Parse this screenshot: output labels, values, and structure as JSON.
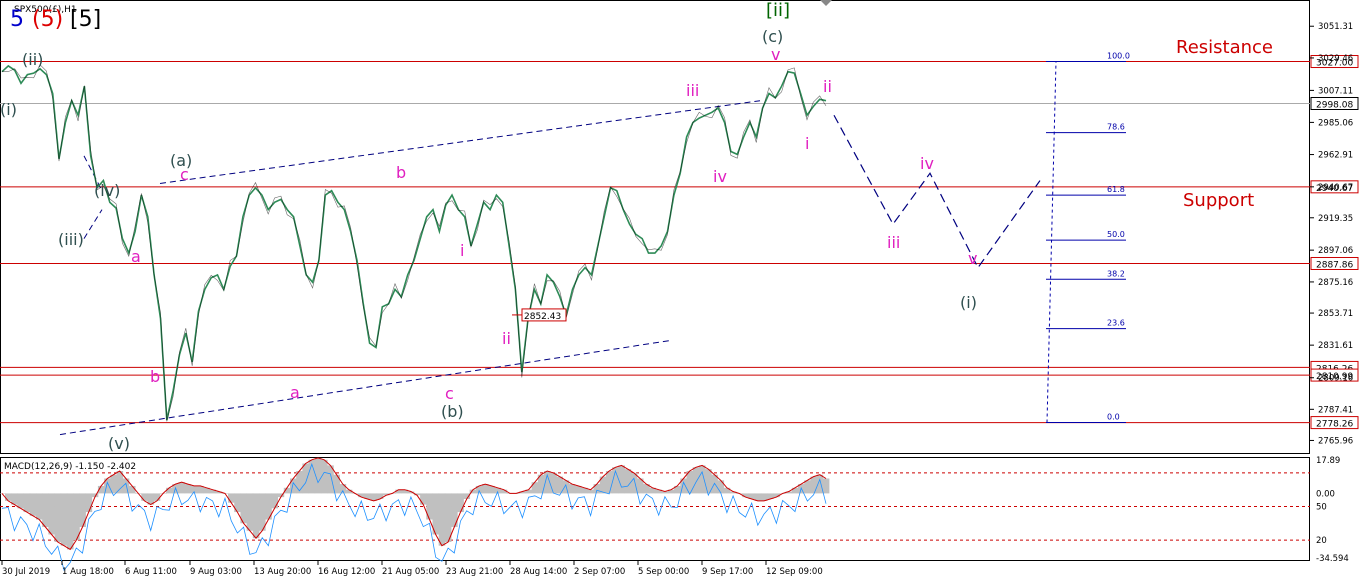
{
  "chart_title": {
    "symbol": "SPX500(£),H1",
    "wave5_blue": "5",
    "wave5_red": "(5)",
    "wave5_black": "[5]",
    "wave_ii_green": "[ii]"
  },
  "chart_data": [
    {
      "type": "line",
      "name": "price",
      "ylim": [
        2758,
        3068
      ],
      "ticks_y": [
        "3051.31",
        "3029.46",
        "3007.11",
        "2985.06",
        "2962.91",
        "2940.67",
        "2919.35",
        "2897.06",
        "2875.16",
        "2853.71",
        "2831.61",
        "2809.16",
        "2787.41",
        "2765.96"
      ],
      "x_ticks": [
        "30 Jul 2019",
        "1 Aug 18:00",
        "6 Aug 11:00",
        "9 Aug 03:00",
        "13 Aug 20:00",
        "16 Aug 12:00",
        "21 Aug 05:00",
        "23 Aug 21:00",
        "28 Aug 14:00",
        "2 Sep 07:00",
        "5 Sep 00:00",
        "9 Sep 17:00",
        "12 Sep 09:00"
      ],
      "levels": [
        {
          "value": 3027.0,
          "label": "3027.00",
          "color": "#cc0000"
        },
        {
          "value": 2998.08,
          "label": "2998.08",
          "color": "#aaaaaa"
        },
        {
          "value": 2940.67,
          "label": "2940.67",
          "color": "#cc0000"
        },
        {
          "value": 2887.86,
          "label": "2887.86",
          "color": "#cc0000"
        },
        {
          "value": 2816.26,
          "label": "2816.26",
          "color": "#cc0000"
        },
        {
          "value": 2810.99,
          "label": "2810.99",
          "color": "#cc0000"
        },
        {
          "value": 2778.26,
          "label": "2778.26",
          "color": "#cc0000"
        }
      ],
      "price_tag": "2852.43",
      "annotations": {
        "resistance": "Resistance",
        "support": "Support"
      },
      "fib_levels": [
        {
          "label": "100.0",
          "value": 3027.0
        },
        {
          "label": "78.6",
          "value": 2978.0
        },
        {
          "label": "61.8",
          "value": 2935.0
        },
        {
          "label": "50.0",
          "value": 2904.0
        },
        {
          "label": "38.2",
          "value": 2877.0
        },
        {
          "label": "23.6",
          "value": 2843.0
        },
        {
          "label": "0.0",
          "value": 2778.3
        }
      ],
      "wave_labels": [
        {
          "text": "(i)",
          "color": "#2f4f4f"
        },
        {
          "text": "(ii)",
          "color": "#2f4f4f"
        },
        {
          "text": "(iii)",
          "color": "#2f4f4f"
        },
        {
          "text": "(iv)",
          "color": "#2f4f4f"
        },
        {
          "text": "(v)",
          "color": "#2f4f4f"
        },
        {
          "text": "a",
          "color": "#e020c0"
        },
        {
          "text": "b",
          "color": "#e020c0"
        },
        {
          "text": "c",
          "color": "#e020c0"
        },
        {
          "text": "(a)",
          "color": "#2f4f4f"
        },
        {
          "text": "a",
          "color": "#e020c0"
        },
        {
          "text": "b",
          "color": "#e020c0"
        },
        {
          "text": "c",
          "color": "#e020c0"
        },
        {
          "text": "(b)",
          "color": "#2f4f4f"
        },
        {
          "text": "i",
          "color": "#e020c0"
        },
        {
          "text": "ii",
          "color": "#e020c0"
        },
        {
          "text": "iii",
          "color": "#e020c0"
        },
        {
          "text": "iv",
          "color": "#e020c0"
        },
        {
          "text": "v",
          "color": "#e020c0"
        },
        {
          "text": "(c)",
          "color": "#2f4f4f"
        },
        {
          "text": "i",
          "color": "#e020c0"
        },
        {
          "text": "ii",
          "color": "#e020c0"
        },
        {
          "text": "iii",
          "color": "#e020c0"
        },
        {
          "text": "iv",
          "color": "#e020c0"
        },
        {
          "text": "v",
          "color": "#e020c0"
        },
        {
          "text": "(i)",
          "color": "#2f4f4f"
        }
      ],
      "series": [
        {
          "values": [
            3020,
            3024,
            3021,
            3012,
            3018,
            3019,
            3022,
            3018,
            3005,
            2960,
            2985,
            3000,
            2990,
            3010,
            2962,
            2940,
            2945,
            2930,
            2926,
            2905,
            2895,
            2910,
            2935,
            2920,
            2880,
            2850,
            2780,
            2800,
            2825,
            2840,
            2820,
            2855,
            2870,
            2878,
            2880,
            2870,
            2886,
            2893,
            2920,
            2935,
            2940,
            2935,
            2925,
            2930,
            2932,
            2925,
            2920,
            2900,
            2880,
            2875,
            2890,
            2935,
            2938,
            2930,
            2925,
            2910,
            2890,
            2860,
            2833,
            2830,
            2858,
            2860,
            2870,
            2865,
            2880,
            2890,
            2905,
            2920,
            2925,
            2910,
            2928,
            2935,
            2925,
            2920,
            2900,
            2915,
            2930,
            2925,
            2935,
            2930,
            2900,
            2870,
            2813,
            2850,
            2870,
            2860,
            2880,
            2875,
            2865,
            2852,
            2870,
            2880,
            2885,
            2880,
            2900,
            2920,
            2940,
            2938,
            2925,
            2915,
            2908,
            2905,
            2895,
            2895,
            2900,
            2910,
            2935,
            2950,
            2975,
            2985,
            2988,
            2990,
            2992,
            2995,
            2985,
            2965,
            2963,
            2975,
            2985,
            2975,
            2995,
            3005,
            3002,
            3010,
            3020,
            3019,
            3005,
            2990,
            2996,
            3001,
            3000
          ]
        }
      ]
    },
    {
      "type": "bar",
      "name": "MACD",
      "title": "MACD(12,26,9) -1.150 -2.402",
      "ticks_y": [
        "17.89",
        "0.00",
        "-34.594"
      ],
      "right_labels": [
        "17.89",
        "0.00",
        "50",
        "20",
        "-34.594"
      ],
      "values": [
        0,
        -4,
        -6,
        -8,
        -10,
        -12,
        -14,
        -18,
        -22,
        -26,
        -28,
        -30,
        -25,
        -18,
        -10,
        -2,
        4,
        8,
        10,
        12,
        8,
        4,
        0,
        -4,
        -6,
        -4,
        0,
        3,
        5,
        6,
        5,
        4,
        4,
        3,
        2,
        1,
        0,
        -5,
        -10,
        -16,
        -20,
        -24,
        -20,
        -14,
        -8,
        -2,
        3,
        8,
        12,
        16,
        18,
        19,
        18,
        15,
        10,
        5,
        2,
        0,
        -2,
        -3,
        -4,
        -3,
        -1,
        0,
        2,
        2,
        1,
        -1,
        -6,
        -14,
        -22,
        -28,
        -26,
        -18,
        -10,
        -3,
        2,
        4,
        5,
        4,
        3,
        2,
        0,
        0,
        1,
        2,
        6,
        10,
        12,
        11,
        9,
        7,
        5,
        4,
        3,
        2,
        5,
        9,
        12,
        14,
        15,
        13,
        11,
        8,
        5,
        3,
        2,
        1,
        2,
        4,
        8,
        12,
        14,
        15,
        13,
        10,
        7,
        3,
        1,
        0,
        -2,
        -3,
        -4,
        -4,
        -3,
        -2,
        0,
        1,
        3,
        5,
        7,
        9,
        10,
        8
      ]
    }
  ]
}
